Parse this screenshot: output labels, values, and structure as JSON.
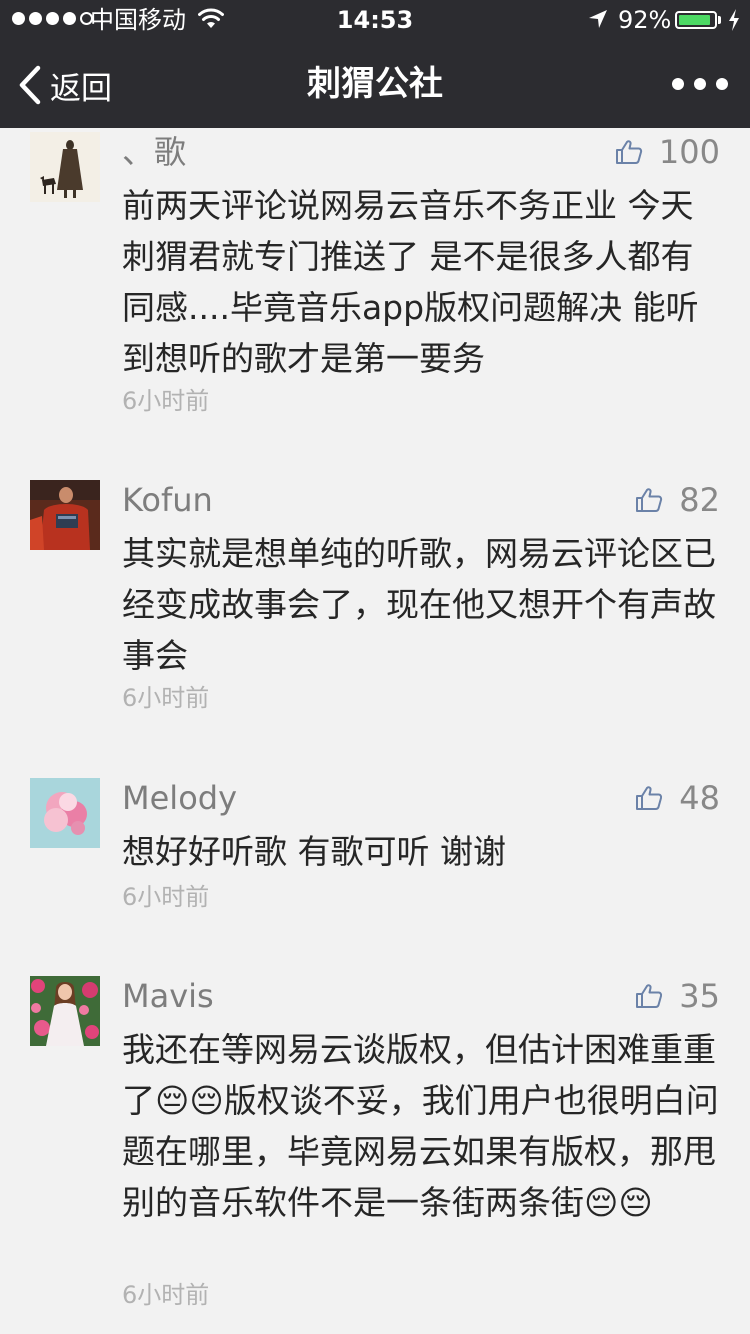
{
  "status_bar": {
    "carrier": "中国移动",
    "time": "14:53",
    "battery_percent_text": "92%",
    "battery_level": 0.92,
    "signal_bars_filled": 4,
    "signal_bars_total": 5
  },
  "nav": {
    "back_label": "返回",
    "title": "刺猬公社",
    "more_icon": "more-dots-icon"
  },
  "colors": {
    "nav_background": "#2c2c30",
    "page_background": "#f2f2f2",
    "battery_green": "#4cd964",
    "nickname_gray": "#7d7d7d",
    "text_dark": "#262626"
  },
  "comments": [
    {
      "nickname": "、歌",
      "likes": "100",
      "text": "前两天评论说网易云音乐不务正业 今天刺猬君就专门推送了  是不是很多人都有同感....毕竟音乐app版权问题解决  能听到想听的歌才是第一要务",
      "time": "6小时前",
      "avatar_icon": "avatar-silhouette-with-dog"
    },
    {
      "nickname": "Kofun",
      "likes": "82",
      "text": "其实就是想单纯的听歌，网易云评论区已经变成故事会了，现在他又想开个有声故事会",
      "time": "6小时前",
      "avatar_icon": "avatar-red-figure"
    },
    {
      "nickname": "Melody",
      "likes": "48",
      "text": "想好好听歌 有歌可听 谢谢",
      "time": "6小时前",
      "avatar_icon": "avatar-pink-smoke"
    },
    {
      "nickname": "Mavis",
      "likes": "35",
      "text": "我还在等网易云谈版权，但估计困难重重了😔😔版权谈不妥，我们用户也很明白问题在哪里，毕竟网易云如果有版权，那甩别的音乐软件不是一条街两条街😔😔",
      "time": "6小时前",
      "avatar_icon": "avatar-girl-in-flowers"
    }
  ]
}
